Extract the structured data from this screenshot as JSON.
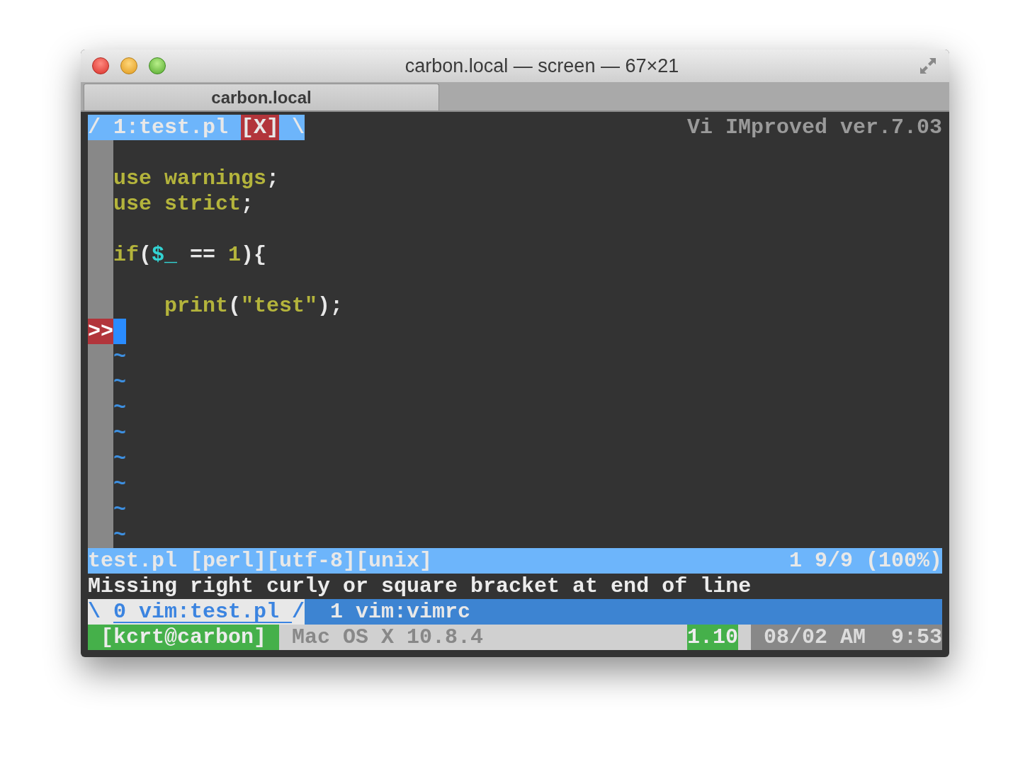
{
  "window": {
    "title": "carbon.local — screen — 67×21"
  },
  "tabs": [
    {
      "label": "carbon.local",
      "selected": true
    }
  ],
  "tabline": {
    "segments": [
      {
        "text": "/ 1:test.pl ",
        "kind": "tab"
      },
      {
        "text": "[X]",
        "kind": "close"
      },
      {
        "text": " \\",
        "kind": "tab"
      }
    ],
    "right": "Vi IMproved ver.7.03"
  },
  "lines": [
    {
      "kind": "code"
    },
    {
      "kind": "code",
      "tokens": [
        {
          "text": "use warnings",
          "kind": "keyword"
        },
        {
          "text": ";",
          "kind": "plain"
        }
      ]
    },
    {
      "kind": "code",
      "tokens": [
        {
          "text": "use strict",
          "kind": "keyword"
        },
        {
          "text": ";",
          "kind": "plain"
        }
      ]
    },
    {
      "kind": "code"
    },
    {
      "kind": "code",
      "tokens": [
        {
          "text": "if",
          "kind": "keyword"
        },
        {
          "text": "(",
          "kind": "plain"
        },
        {
          "text": "$_",
          "kind": "variable"
        },
        {
          "text": " == ",
          "kind": "plain"
        },
        {
          "text": "1",
          "kind": "number"
        },
        {
          "text": "){",
          "kind": "plain"
        }
      ]
    },
    {
      "kind": "code"
    },
    {
      "kind": "code",
      "tokens": [
        {
          "text": "    print",
          "kind": "keyword"
        },
        {
          "text": "(",
          "kind": "plain"
        },
        {
          "text": "\"test\"",
          "kind": "string"
        },
        {
          "text": ");",
          "kind": "plain"
        }
      ]
    },
    {
      "kind": "code",
      "sign": ">>",
      "cursor": true
    },
    {
      "kind": "filler",
      "text": "~"
    },
    {
      "kind": "filler",
      "text": "~"
    },
    {
      "kind": "filler",
      "text": "~"
    },
    {
      "kind": "filler",
      "text": "~"
    },
    {
      "kind": "filler",
      "text": "~"
    },
    {
      "kind": "filler",
      "text": "~"
    },
    {
      "kind": "filler",
      "text": "~"
    },
    {
      "kind": "filler",
      "text": "~"
    }
  ],
  "status_line": {
    "left": "test.pl [perl][utf-8][unix]",
    "right": "1 9/9 (100%)"
  },
  "message": "Missing right curly or square bracket at end of line",
  "screen_windows": [
    {
      "prefix": "\\",
      "label": "0 vim:test.pl",
      "suffix": "/",
      "selected": true
    },
    {
      "label": "1 vim:vimrc",
      "selected": false
    }
  ],
  "hardstatus": {
    "host": "[kcrt@carbon]",
    "os": "Mac OS X 10.8.4",
    "load": "1.10",
    "date": "08/02 AM",
    "time": "9:53"
  }
}
